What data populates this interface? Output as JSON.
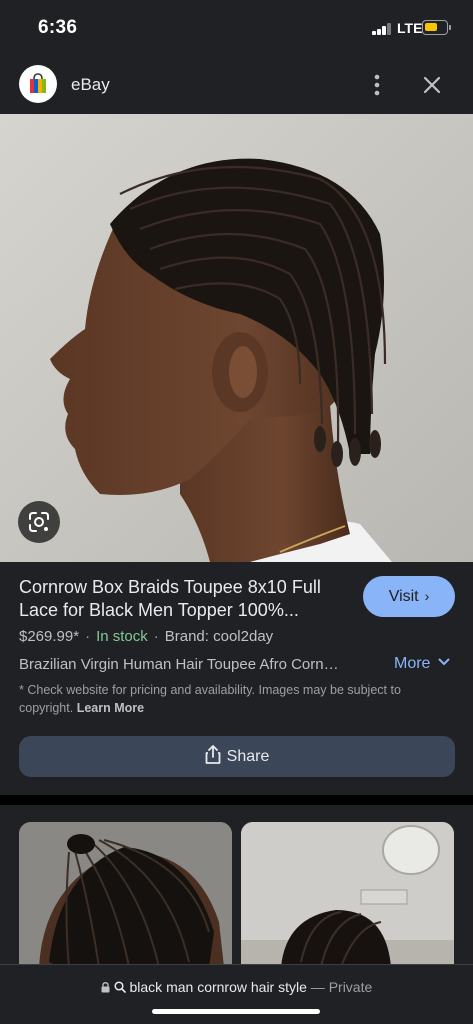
{
  "status_bar": {
    "time": "6:36",
    "network": "LTE",
    "battery_level": 0.6
  },
  "header": {
    "site_name": "eBay",
    "more_icon": "vertical-dots-icon",
    "close_icon": "close-icon"
  },
  "hero": {
    "lens_icon": "google-lens-icon"
  },
  "product": {
    "title": "Cornrow Box Braids Toupee 8x10 Full Lace for Black Men Topper 100%...",
    "visit_label": "Visit",
    "price": "$269.99*",
    "availability": "In stock",
    "brand": "Brand: cool2day",
    "description": "Brazilian Virgin Human Hair Toupee Afro Corn…",
    "more_label": "More",
    "disclaimer": "* Check website for pricing and availability. Images may be subject to copyright.",
    "learn_more": "Learn More",
    "share_label": "Share"
  },
  "bottom_bar": {
    "query": "black man cornrow hair style",
    "separator": "—",
    "private_label": "Private"
  },
  "colors": {
    "accent_blue": "#8ab4f8",
    "in_stock_green": "#81c995",
    "battery_yellow": "#f6c700",
    "background": "#202124"
  }
}
